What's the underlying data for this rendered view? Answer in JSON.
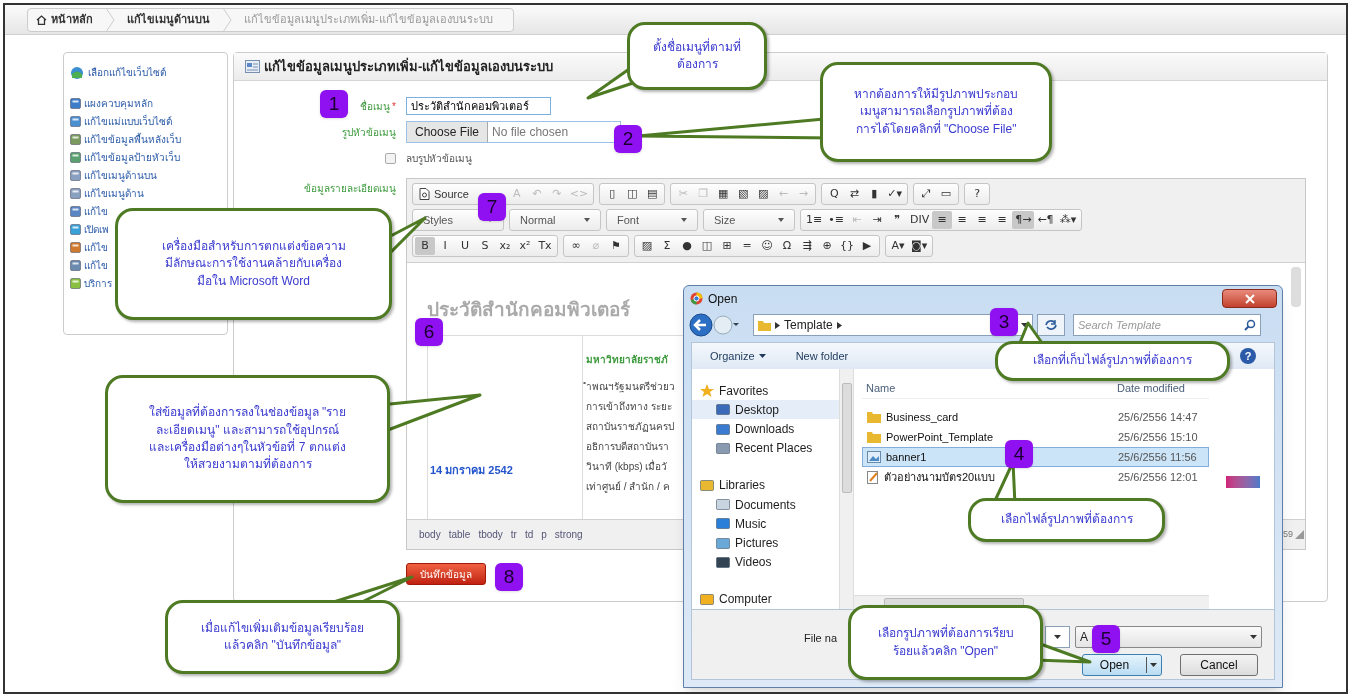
{
  "breadcrumb": [
    {
      "label": "หน้าหลัก",
      "kind": "home"
    },
    {
      "label": "แก้ไขเมนูด้านบน",
      "kind": "link"
    },
    {
      "label": "แก้ไขข้อมูลเมนูประเภทเพิ่ม-แก้ไขข้อมูลเองบนระบบ",
      "kind": "current"
    }
  ],
  "sidebar": {
    "title": "เลือกแก้ไขเว็บไซต์",
    "items": [
      "แผงควบคุมหลัก",
      "แก้ไขแม่แบบเว็บไซต์",
      "แก้ไขข้อมูลพื้นหลังเว็บ",
      "แก้ไขข้อมูลป้ายหัวเว็บ",
      "แก้ไขเมนูด้านบน",
      "แก้ไขเมนูด้าน",
      "แก้ไข",
      "เปิดเพ",
      "แก้ไข",
      "แก้ไข",
      "บริการ"
    ]
  },
  "panel": {
    "title": "แก้ไขข้อมูลเมนูประเภทเพิ่ม-แก้ไขข้อมูลเองบนระบบ"
  },
  "form": {
    "name_label": "ชื่อเมนู",
    "required_mark": "*",
    "name_value": "ประวัติสำนักคอมพิวเตอร์",
    "image_label": "รูปหัวข้อเมนู",
    "file_button": "Choose File",
    "file_status": "No file chosen",
    "delete_image": {
      "label": "ลบรูปหัวข้อเมนู",
      "checked": false
    },
    "detail_label": "ข้อมูลรายละเอียดเมนู"
  },
  "editor": {
    "toolbar": [
      [
        [
          {
            "kind": "source",
            "label": "Source",
            "active": false,
            "disabled": false
          },
          {
            "kind": "button",
            "label": "A",
            "active": false,
            "disabled": true
          },
          {
            "kind": "button",
            "label": "↶",
            "active": false,
            "disabled": true
          },
          {
            "kind": "button",
            "label": "↷",
            "active": false,
            "disabled": true
          },
          {
            "kind": "button",
            "label": "<>",
            "active": false,
            "disabled": true
          }
        ],
        [
          {
            "kind": "button",
            "label": "▯",
            "active": false,
            "disabled": false
          },
          {
            "kind": "button",
            "label": "◫",
            "active": false,
            "disabled": false
          },
          {
            "kind": "button",
            "label": "▤",
            "active": false,
            "disabled": false
          }
        ],
        [
          {
            "kind": "button",
            "label": "✂",
            "active": false,
            "disabled": true
          },
          {
            "kind": "button",
            "label": "❐",
            "active": false,
            "disabled": true
          },
          {
            "kind": "button",
            "label": "▦",
            "active": false,
            "disabled": false
          },
          {
            "kind": "button",
            "label": "▧",
            "active": false,
            "disabled": false
          },
          {
            "kind": "button",
            "label": "▨",
            "active": false,
            "disabled": false
          },
          {
            "kind": "button",
            "label": "←",
            "active": false,
            "disabled": true
          },
          {
            "kind": "button",
            "label": "→",
            "active": false,
            "disabled": true
          }
        ],
        [
          {
            "kind": "button",
            "label": "Q",
            "active": false,
            "disabled": false
          },
          {
            "kind": "button",
            "label": "⇄",
            "active": false,
            "disabled": false
          },
          {
            "kind": "button",
            "label": "▮",
            "active": false,
            "disabled": false
          },
          {
            "kind": "button",
            "label": "✓▾",
            "active": false,
            "disabled": false
          }
        ],
        [
          {
            "kind": "button",
            "label": "⤢",
            "active": false,
            "disabled": false
          },
          {
            "kind": "button",
            "label": "▭",
            "active": false,
            "disabled": false
          }
        ],
        [
          {
            "kind": "button",
            "label": "?",
            "active": false,
            "disabled": false
          }
        ]
      ],
      [
        [
          {
            "kind": "combo",
            "label": "Styles"
          }
        ],
        [
          {
            "kind": "combo",
            "label": "Normal"
          }
        ],
        [
          {
            "kind": "combo",
            "label": "Font"
          }
        ],
        [
          {
            "kind": "combo",
            "label": "Size"
          }
        ],
        [
          {
            "kind": "button",
            "label": "1≡",
            "active": false,
            "disabled": false
          },
          {
            "kind": "button",
            "label": "•≡",
            "active": false,
            "disabled": false
          },
          {
            "kind": "button",
            "label": "⇤",
            "active": false,
            "disabled": true
          },
          {
            "kind": "button",
            "label": "⇥",
            "active": false,
            "disabled": false
          },
          {
            "kind": "button",
            "label": "❞",
            "active": false,
            "disabled": false
          },
          {
            "kind": "button",
            "label": "DIV",
            "active": false,
            "disabled": false
          },
          {
            "kind": "button",
            "label": "≡",
            "active": true,
            "disabled": false
          },
          {
            "kind": "button",
            "label": "≡",
            "active": false,
            "disabled": false
          },
          {
            "kind": "button",
            "label": "≡",
            "active": false,
            "disabled": false
          },
          {
            "kind": "button",
            "label": "≡",
            "active": false,
            "disabled": false
          },
          {
            "kind": "button",
            "label": "¶→",
            "active": true,
            "disabled": false
          },
          {
            "kind": "button",
            "label": "←¶",
            "active": false,
            "disabled": false
          },
          {
            "kind": "button",
            "label": "⁂▾",
            "active": false,
            "disabled": false
          }
        ]
      ],
      [
        [
          {
            "kind": "button",
            "label": "B",
            "active": true,
            "disabled": false
          },
          {
            "kind": "button",
            "label": "I",
            "active": false,
            "disabled": false
          },
          {
            "kind": "button",
            "label": "U",
            "active": false,
            "disabled": false
          },
          {
            "kind": "button",
            "label": "S",
            "active": false,
            "disabled": false
          },
          {
            "kind": "button",
            "label": "x₂",
            "active": false,
            "disabled": false
          },
          {
            "kind": "button",
            "label": "x²",
            "active": false,
            "disabled": false
          },
          {
            "kind": "button",
            "label": "Tx",
            "active": false,
            "disabled": false
          }
        ],
        [
          {
            "kind": "button",
            "label": "∞",
            "active": false,
            "disabled": false
          },
          {
            "kind": "button",
            "label": "⌀",
            "active": false,
            "disabled": true
          },
          {
            "kind": "button",
            "label": "⚑",
            "active": false,
            "disabled": false
          }
        ],
        [
          {
            "kind": "button",
            "label": "▨",
            "active": false,
            "disabled": false
          },
          {
            "kind": "button",
            "label": "Σ",
            "active": false,
            "disabled": false
          },
          {
            "kind": "button",
            "label": "●",
            "active": false,
            "disabled": false
          },
          {
            "kind": "button",
            "label": "◫",
            "active": false,
            "disabled": false
          },
          {
            "kind": "button",
            "label": "⊞",
            "active": false,
            "disabled": false
          },
          {
            "kind": "button",
            "label": "═",
            "active": false,
            "disabled": false
          },
          {
            "kind": "button",
            "label": "☺",
            "active": false,
            "disabled": false
          },
          {
            "kind": "button",
            "label": "Ω",
            "active": false,
            "disabled": false
          },
          {
            "kind": "button",
            "label": "⇶",
            "active": false,
            "disabled": false
          },
          {
            "kind": "button",
            "label": "⊕",
            "active": false,
            "disabled": false
          },
          {
            "kind": "button",
            "label": "{}",
            "active": false,
            "disabled": false
          },
          {
            "kind": "button",
            "label": "▶",
            "active": false,
            "disabled": false
          }
        ],
        [
          {
            "kind": "button",
            "label": "A▾",
            "active": false,
            "disabled": false
          },
          {
            "kind": "button",
            "label": "◙▾",
            "active": false,
            "disabled": false
          }
        ]
      ]
    ],
    "heading": "ประวัติสำนักคอมพิวเตอร์",
    "date": "14 มกราคม 2542",
    "org": "มหาวิทยาลัยราชภั",
    "lines": [
      "ำพณฯรัฐมนตรีช่วยว",
      "การเข้าถึงทาง ระยะ",
      "สถาบันราชภัฏนครป",
      "อธิการบดีสถาบันรา",
      "วินาที (kbps) เมื่อวั",
      "เท่าศูนย์ / สำนัก / ค"
    ],
    "path": [
      "body",
      "table",
      "tbody",
      "tr",
      "td",
      "p",
      "strong"
    ],
    "corner_text": "59"
  },
  "save_button": "บันทึกข้อมูล",
  "dialog": {
    "title": "Open",
    "path": "Template",
    "search_placeholder": "Search Template",
    "toolbar": [
      {
        "label": "Organize",
        "menu": true
      },
      {
        "label": "New folder",
        "menu": false
      }
    ],
    "help_label": "?",
    "nav": [
      {
        "label": "Favorites",
        "kind": "group",
        "selected": false
      },
      {
        "label": "Desktop",
        "kind": "item",
        "selected": true
      },
      {
        "label": "Downloads",
        "kind": "item",
        "selected": false
      },
      {
        "label": "Recent Places",
        "kind": "item",
        "selected": false
      },
      {
        "label": "Libraries",
        "kind": "group",
        "selected": false
      },
      {
        "label": "Documents",
        "kind": "item",
        "selected": false
      },
      {
        "label": "Music",
        "kind": "item",
        "selected": false
      },
      {
        "label": "Pictures",
        "kind": "item",
        "selected": false
      },
      {
        "label": "Videos",
        "kind": "item",
        "selected": false
      },
      {
        "label": "Computer",
        "kind": "group",
        "selected": false
      }
    ],
    "columns": [
      "Name",
      "Date modified"
    ],
    "files": [
      {
        "name": "Business_card",
        "modified": "25/6/2556 14:47",
        "kind": "folder",
        "selected": false
      },
      {
        "name": "PowerPoint_Template",
        "modified": "25/6/2556 15:10",
        "kind": "folder",
        "selected": false
      },
      {
        "name": "banner1",
        "modified": "25/6/2556 11:56",
        "kind": "image",
        "selected": true
      },
      {
        "name": "ตัวอย่างนามบัตร20แบบ",
        "modified": "25/6/2556 12:01",
        "kind": "document",
        "selected": false
      }
    ],
    "file_name_label": "File na",
    "file_type": "A",
    "buttons": [
      {
        "label": "Open",
        "kind": "split"
      },
      {
        "label": "Cancel",
        "kind": "plain"
      }
    ]
  },
  "callouts": [
    "ตั้งชื่อเมนูที่ตามที่\nต้องการ",
    "หากต้องการให้มีรูปภาพประกอบ\nเมนูสามารถเลือกรูปภาพที่ต้อง\nการได้โดยคลิกที่ \"Choose File\"",
    "เครื่องมือสำหรับการตกแต่งข้อความ\nมีลักษณะการใช้งานคล้ายกับเครื่อง\nมือใน Microsoft Word",
    "ใส่ข้อมูลที่ต้องการลงในช่องข้อมูล \"ราย\nละเอียดเมนู\" และสามารถใช้อุปกรณ์\nและเครื่องมือต่างๆในหัวข้อที่ 7 ตกแต่ง\nให้สวยงามตามที่ต้องการ",
    "เลือกที่เก็บไฟล์รูปภาพที่ต้องการ",
    "เลือกไฟล์รูปภาพที่ต้องการ",
    "เมื่อแก้ไขเพิ่มเติมข้อมูลเรียบร้อย\nแล้วคลิก \"บันทึกข้อมูล\"",
    "เลือกรูปภาพที่ต้องการเรียบ\nร้อยแล้วคลิก \"Open\""
  ],
  "badges": [
    "1",
    "2",
    "3",
    "4",
    "5",
    "6",
    "7",
    "8"
  ]
}
